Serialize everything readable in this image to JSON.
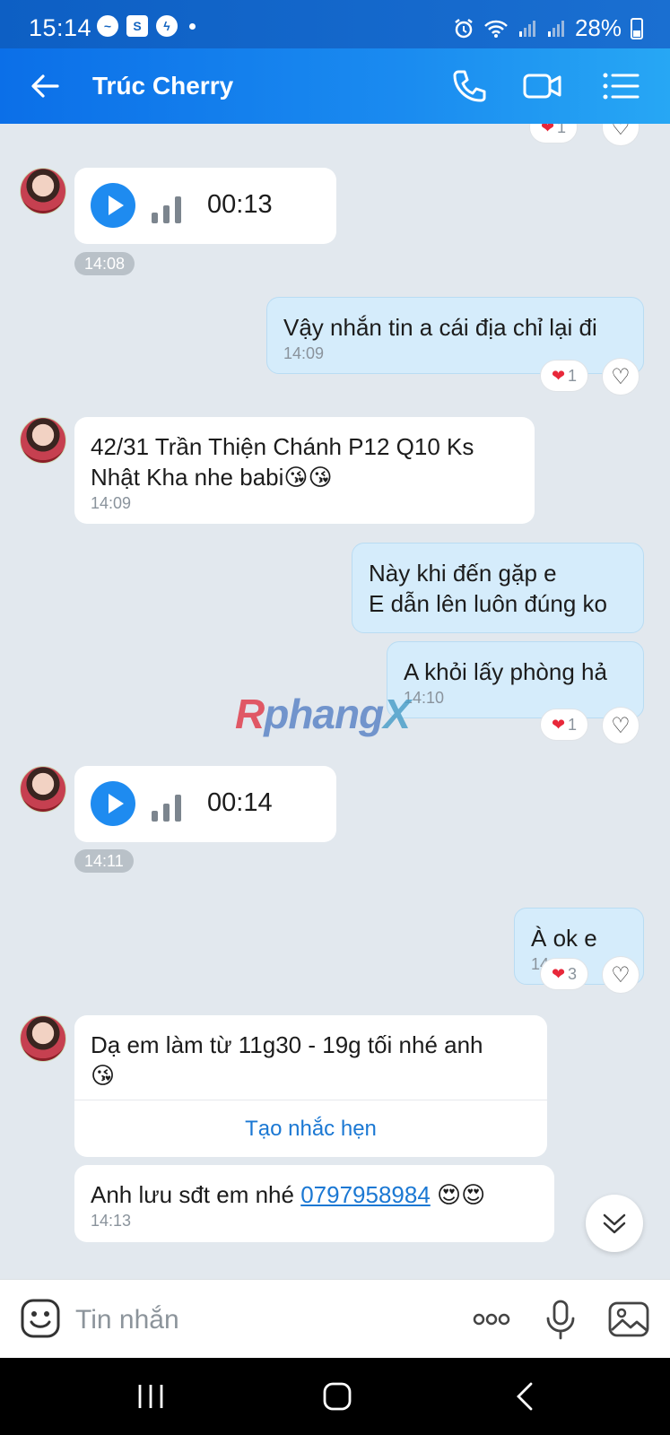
{
  "status_bar": {
    "time": "15:14",
    "battery": "28%"
  },
  "header": {
    "title": "Trúc Cherry"
  },
  "messages": {
    "m1": {
      "duration": "00:13",
      "time": "14:08"
    },
    "m2": {
      "text": "Vậy nhắn tin a cái địa chỉ lại đi",
      "time": "14:09",
      "heart_count": "1"
    },
    "m3": {
      "text": "42/31 Trần Thiện Chánh P12 Q10 Ks\nNhật Kha nhe babi😘😘",
      "time": "14:09"
    },
    "m4": {
      "text": "Này khi đến gặp e\nE dẫn lên luôn đúng ko"
    },
    "m5": {
      "text": "A khỏi lấy phòng hả",
      "time": "14:10",
      "heart_count": "1"
    },
    "m6": {
      "duration": "00:14",
      "time": "14:11"
    },
    "m7": {
      "text": "À ok e",
      "time": "14:11",
      "heart_count": "3"
    },
    "m8": {
      "text": "Dạ em làm từ 11g30 - 19g tối nhé anh\n😘",
      "action": "Tạo nhắc hẹn"
    },
    "m9": {
      "text_before": "Anh lưu sđt em nhé ",
      "phone": "0797958984",
      "text_after": " 😍😍",
      "time": "14:13"
    },
    "top_heart_count": "1"
  },
  "input": {
    "placeholder": "Tin nhắn"
  },
  "watermark": {
    "text_r": "R",
    "text_mid": "phang",
    "text_x": "X"
  },
  "icons": {
    "back": "arrow-left-icon",
    "call": "phone-icon",
    "video": "video-camera-icon",
    "menu": "list-icon",
    "emoji": "emoji-icon",
    "more": "more-dots-icon",
    "mic": "microphone-icon",
    "gallery": "image-icon",
    "scroll": "chevron-double-down-icon",
    "heart": "heart-icon",
    "like": "heart-outline-icon"
  },
  "colors": {
    "accent": "#1e8bf0",
    "header_start": "#0b6fe8",
    "header_end": "#27a7f4",
    "outgoing_bubble": "#d5ecfb"
  }
}
